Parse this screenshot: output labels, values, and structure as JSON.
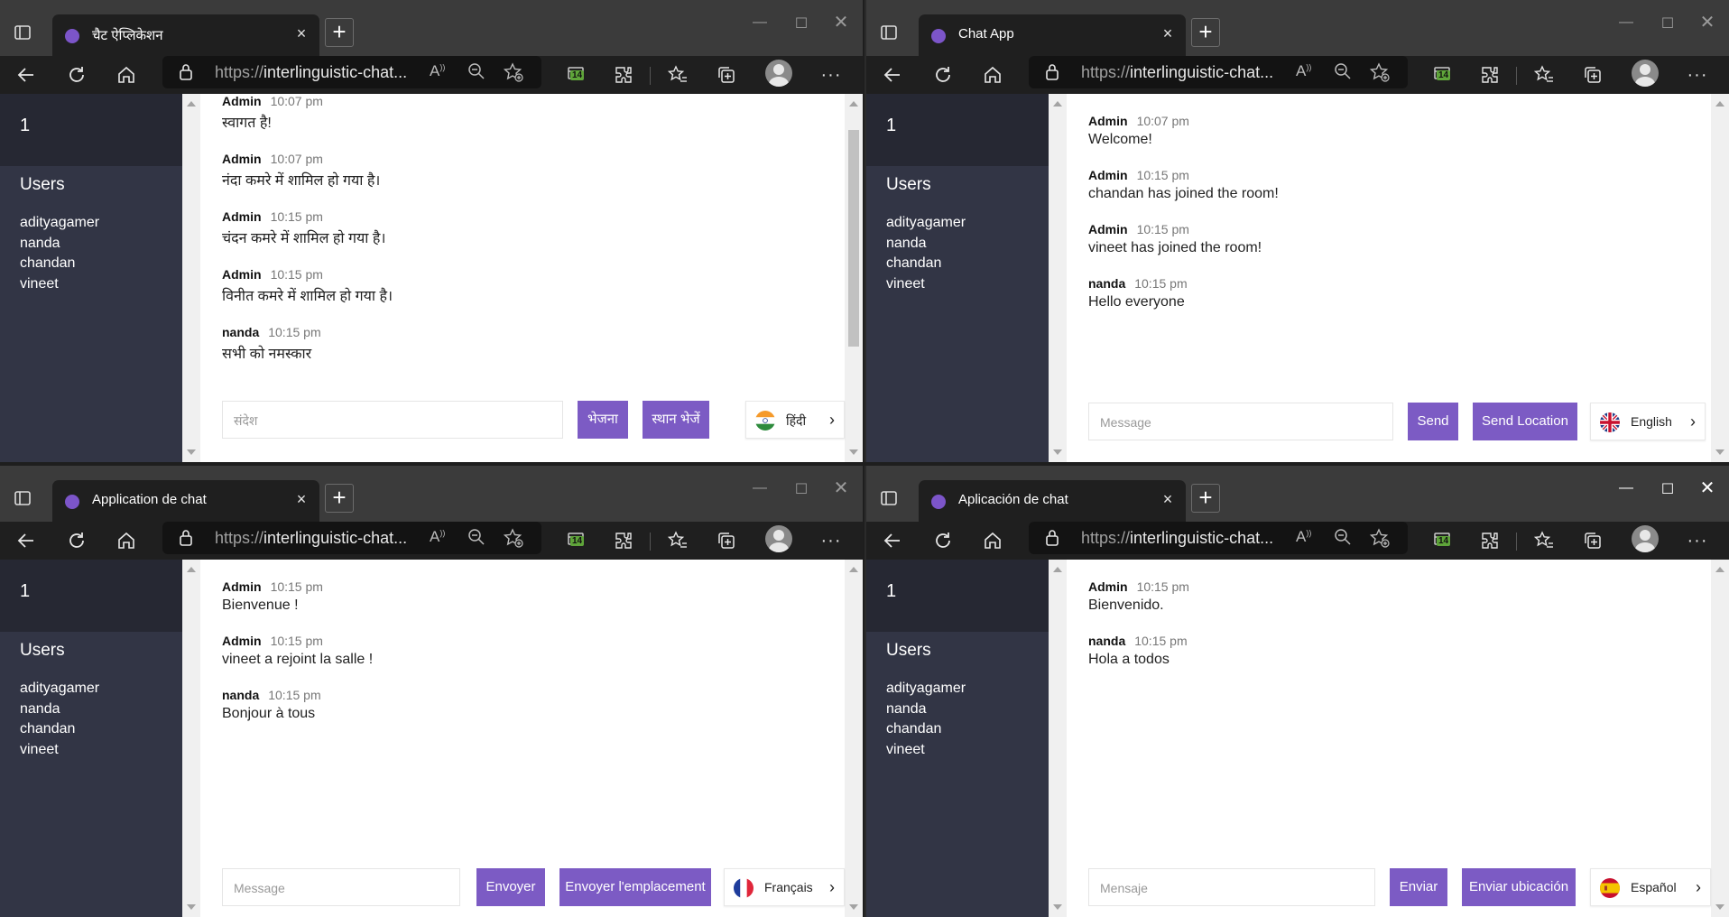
{
  "browser": {
    "address_prefix": "https://",
    "address_host": "interlinguistic-chat...",
    "badge_count": "14",
    "new_tab_glyph": "+",
    "close_glyph": "×"
  },
  "windows": [
    {
      "tab_title": "चैट ऐप्लिकेशन",
      "room": "1",
      "users_heading": "Users",
      "users": [
        "adityagamer",
        "nanda",
        "chandan",
        "vineet"
      ],
      "messages": [
        {
          "user": "Admin",
          "time": "10:07 pm",
          "text": "स्वागत है!"
        },
        {
          "user": "Admin",
          "time": "10:07 pm",
          "text": "नंदा कमरे में शामिल हो गया है।"
        },
        {
          "user": "Admin",
          "time": "10:15 pm",
          "text": "चंदन कमरे में शामिल हो गया है।"
        },
        {
          "user": "Admin",
          "time": "10:15 pm",
          "text": "विनीत कमरे में शामिल हो गया है।"
        },
        {
          "user": "nanda",
          "time": "10:15 pm",
          "text": "सभी को नमस्कार"
        }
      ],
      "input_placeholder": "संदेश",
      "send_label": "भेजना",
      "location_label": "स्थान भेजें",
      "language": "हिंदी",
      "flag": "india-flag-icon"
    },
    {
      "tab_title": "Chat App",
      "room": "1",
      "users_heading": "Users",
      "users": [
        "adityagamer",
        "nanda",
        "chandan",
        "vineet"
      ],
      "messages": [
        {
          "user": "Admin",
          "time": "10:07 pm",
          "text": "Welcome!"
        },
        {
          "user": "Admin",
          "time": "10:15 pm",
          "text": "chandan has joined the room!"
        },
        {
          "user": "Admin",
          "time": "10:15 pm",
          "text": "vineet has joined the room!"
        },
        {
          "user": "nanda",
          "time": "10:15 pm",
          "text": "Hello everyone"
        }
      ],
      "input_placeholder": "Message",
      "send_label": "Send",
      "location_label": "Send Location",
      "language": "English",
      "flag": "uk-flag-icon"
    },
    {
      "tab_title": "Application de chat",
      "room": "1",
      "users_heading": "Users",
      "users": [
        "adityagamer",
        "nanda",
        "chandan",
        "vineet"
      ],
      "messages": [
        {
          "user": "Admin",
          "time": "10:15 pm",
          "text": "Bienvenue !"
        },
        {
          "user": "Admin",
          "time": "10:15 pm",
          "text": "vineet a rejoint la salle !"
        },
        {
          "user": "nanda",
          "time": "10:15 pm",
          "text": "Bonjour à tous"
        }
      ],
      "input_placeholder": "Message",
      "send_label": "Envoyer",
      "location_label": "Envoyer l'emplacement",
      "language": "Français",
      "flag": "france-flag-icon"
    },
    {
      "tab_title": "Aplicación de chat",
      "room": "1",
      "users_heading": "Users",
      "users": [
        "adityagamer",
        "nanda",
        "chandan",
        "vineet"
      ],
      "messages": [
        {
          "user": "Admin",
          "time": "10:15 pm",
          "text": "Bienvenido."
        },
        {
          "user": "nanda",
          "time": "10:15 pm",
          "text": "Hola a todos"
        }
      ],
      "input_placeholder": "Mensaje",
      "send_label": "Enviar",
      "location_label": "Enviar ubicación",
      "language": "Español",
      "flag": "spain-flag-icon"
    }
  ],
  "colors": {
    "accent": "#7c5bc4",
    "sidebar": "#323545",
    "room_header": "#262833",
    "tab_dot": "#7c55c9"
  }
}
